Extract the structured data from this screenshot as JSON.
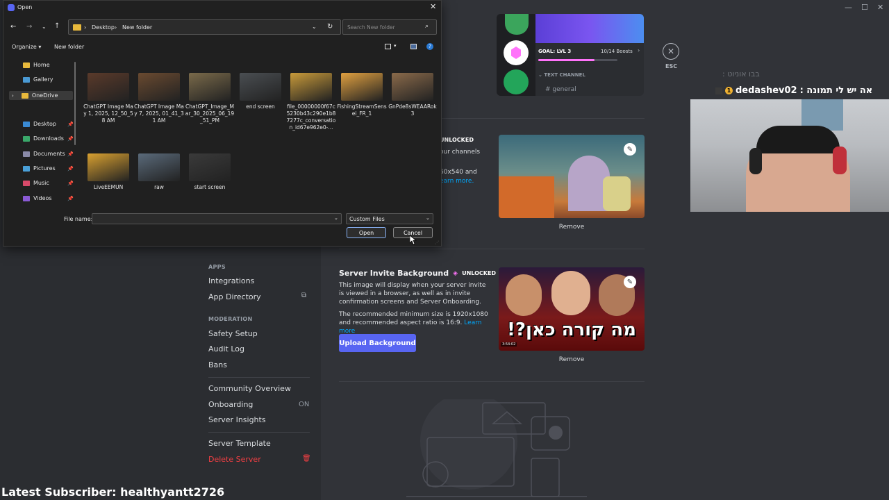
{
  "dialog": {
    "title": "Open",
    "breadcrumb": [
      "Desktop",
      "New folder"
    ],
    "search_placeholder": "Search New folder",
    "toolbar": {
      "organize": "Organize",
      "new_folder": "New folder"
    },
    "sidebar": [
      {
        "label": "Home",
        "pinned": false
      },
      {
        "label": "Gallery",
        "pinned": false
      },
      {
        "label": "OneDrive",
        "pinned": false
      },
      {
        "label": "Desktop",
        "pinned": true
      },
      {
        "label": "Downloads",
        "pinned": true
      },
      {
        "label": "Documents",
        "pinned": true
      },
      {
        "label": "Pictures",
        "pinned": true
      },
      {
        "label": "Music",
        "pinned": true
      },
      {
        "label": "Videos",
        "pinned": true
      }
    ],
    "files": [
      {
        "name": "ChatGPT Image May 1, 2025, 12_50_58 AM",
        "color": "#5a3a2a"
      },
      {
        "name": "ChatGPT Image May 7, 2025, 01_41_31 AM",
        "color": "#6a4a30"
      },
      {
        "name": "ChatGPT_Image_Mar_30_2025_06_19_51_PM",
        "color": "#7a6a4a"
      },
      {
        "name": "end screen",
        "color": "#4a4e52"
      },
      {
        "name": "file_00000000f67c5230b43c290e1b87277c_conversation_id67e962e0-...",
        "color": "#c89a3a"
      },
      {
        "name": "FishingStreamSensei_FR_1",
        "color": "#e0a040"
      },
      {
        "name": "GnPde8sWEAARok3",
        "color": "#8a6a4a"
      },
      {
        "name": "LiveEEMUN",
        "color": "#d8a030"
      },
      {
        "name": "raw",
        "color": "#5a6a7a"
      },
      {
        "name": "start screen",
        "color": "#3a3a3a"
      }
    ],
    "file_name_label": "File name:",
    "file_name_value": "",
    "file_type": "Custom Files",
    "open_button": "Open",
    "cancel_button": "Cancel"
  },
  "discord": {
    "server_card": {
      "goal": "GOAL: LVL 3",
      "boosts": "10/14 Boosts",
      "progress": 0.714,
      "channel_category": "TEXT CHANNEL",
      "channel_name": "general"
    },
    "esc_label": "ESC",
    "banner_section": {
      "badge": "UNLOCKED",
      "desc_fragment_1": "our channels",
      "desc_fragment_2": "60x540 and",
      "learn_more": "earn more.",
      "remove": "Remove"
    },
    "invite_section": {
      "title": "Server Invite Background",
      "badge": "UNLOCKED",
      "description": "This image will display when your server invite is viewed in a browser, as well as in invite confirmation screens and Server Onboarding.",
      "recommendation": "The recommended minimum size is 1920x1080 and recommended aspect ratio is 16:9.",
      "learn_more": "Learn more",
      "upload_button": "Upload Background",
      "remove": "Remove",
      "overlay_text": "מה קורה כאן?!",
      "timestamp": "3:54:02"
    },
    "nav": {
      "apps_header": "APPS",
      "integrations": "Integrations",
      "app_directory": "App Directory",
      "moderation_header": "MODERATION",
      "safety_setup": "Safety Setup",
      "audit_log": "Audit Log",
      "bans": "Bans",
      "community_overview": "Community Overview",
      "onboarding": "Onboarding",
      "onboarding_state": "ON",
      "server_insights": "Server Insights",
      "server_template": "Server Template",
      "delete_server": "Delete Server"
    }
  },
  "stream_overlay": {
    "chat_user": "dedashev02",
    "chat_message": "אה יש לי תמונה :",
    "chat_faded": "בבו אוניוט :",
    "latest_subscriber": "Latest Subscriber: healthyantt2726"
  },
  "colors": {
    "blurple": "#5865f2",
    "link": "#00a8fc",
    "danger": "#f23f43",
    "boost_pink": "#ff73fa"
  }
}
